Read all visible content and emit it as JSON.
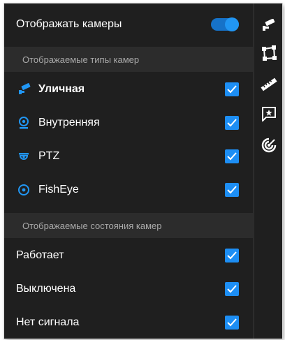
{
  "main_toggle": {
    "label": "Отображать камеры",
    "checked": true
  },
  "camera_types": {
    "header": "Отображаемые типы камер",
    "items": [
      {
        "label": "Уличная",
        "icon": "street-camera-icon",
        "checked": true
      },
      {
        "label": "Внутренняя",
        "icon": "indoor-camera-icon",
        "checked": true
      },
      {
        "label": "PTZ",
        "icon": "ptz-camera-icon",
        "checked": true
      },
      {
        "label": "FishEye",
        "icon": "fisheye-camera-icon",
        "checked": true
      }
    ]
  },
  "camera_states": {
    "header": "Отображаемые состояния камер",
    "items": [
      {
        "label": "Работает",
        "checked": true
      },
      {
        "label": "Выключена",
        "checked": true
      },
      {
        "label": "Нет сигнала",
        "checked": true
      }
    ]
  },
  "sidebar": {
    "tools": [
      {
        "icon": "cctv-camera-icon"
      },
      {
        "icon": "polygon-icon"
      },
      {
        "icon": "ruler-icon"
      },
      {
        "icon": "star-comment-icon"
      },
      {
        "icon": "radar-icon"
      }
    ]
  },
  "colors": {
    "accent": "#2196f3",
    "background": "#1f1f1f",
    "section_bg": "#2c2c2c",
    "icon": "#ffffff",
    "type_icon": "#2196f3"
  }
}
